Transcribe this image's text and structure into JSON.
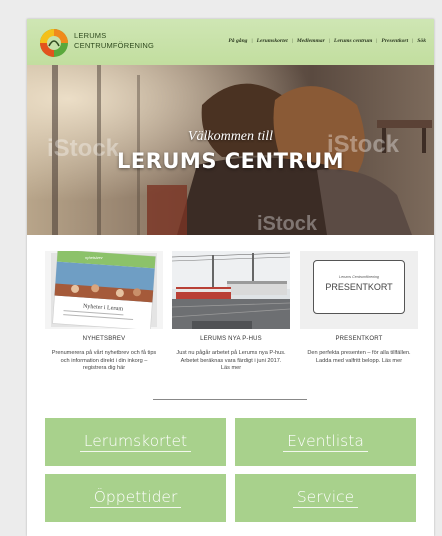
{
  "header": {
    "logo_line1": "LERUMS",
    "logo_line2": "CENTRUMFÖRENING",
    "nav": [
      "På gång",
      "Lerumskortet",
      "Medlemmar",
      "Lerums centrum",
      "Presentkort",
      "Sök"
    ],
    "nav_separator": "|"
  },
  "hero": {
    "subtitle": "Välkommen till",
    "title": "LERUMS CENTRUM",
    "watermark": "iStock"
  },
  "cards": [
    {
      "image_caption": "Nyheter i Lerum",
      "image_header": "nyhetsbrev",
      "title": "NYHETSBREV",
      "description": "Prenumerera på vårt nyhetbrev och få tips och information direkt i din inkorg – registrera dig här"
    },
    {
      "title": "LERUMS NYA P-HUS",
      "description": "Just nu pågår arbetet på Lerums nya P-hus. Arbetet beräknas vara färdigt i juni 2017. Läs mer"
    },
    {
      "image_small_text": "Lerums Centrumförening",
      "image_text": "PRESENTKORT",
      "title": "PRESENTKORT",
      "description": "Den perfekta presenten – för alla tillfällen. Ladda med valfritt belopp. Läs mer"
    }
  ],
  "buttons": [
    "Lerumskortet",
    "Eventlista",
    "Öppettider",
    "Service"
  ],
  "colors": {
    "header_bg": "#c7e1a8",
    "button_bg": "#a8d18c",
    "logo_orange": "#f08a1c",
    "logo_green": "#5aa83c"
  }
}
